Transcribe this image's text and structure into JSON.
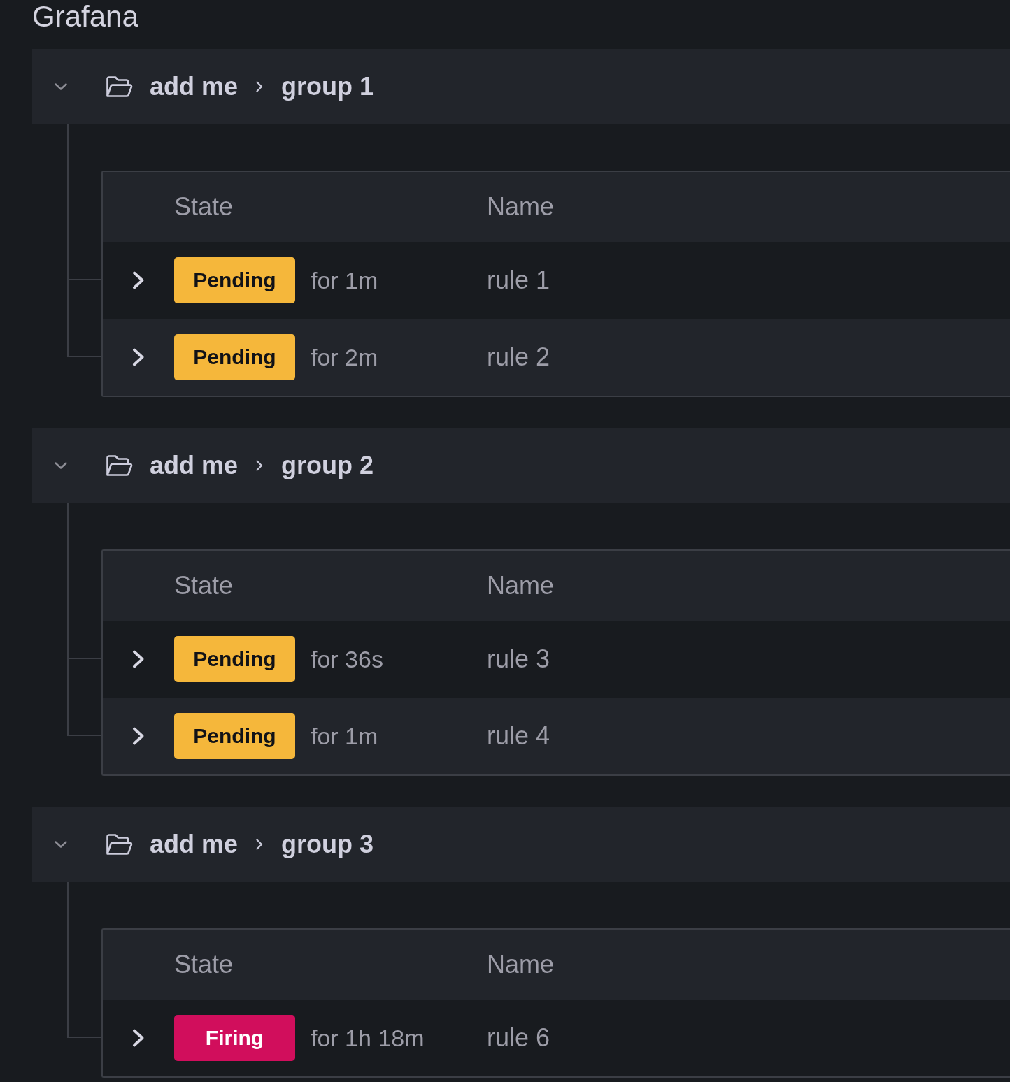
{
  "datasource": {
    "title": "Grafana"
  },
  "groups": [
    {
      "folder": "add me",
      "name": "group 1",
      "expanded": true,
      "columns": [
        "State",
        "Name"
      ],
      "rules": [
        {
          "state": "Pending",
          "kind": "pending",
          "duration": "for 1m",
          "name": "rule 1",
          "expanded": false
        },
        {
          "state": "Pending",
          "kind": "pending",
          "duration": "for 2m",
          "name": "rule 2",
          "expanded": false
        }
      ]
    },
    {
      "folder": "add me",
      "name": "group 2",
      "expanded": true,
      "columns": [
        "State",
        "Name"
      ],
      "rules": [
        {
          "state": "Pending",
          "kind": "pending",
          "duration": "for 36s",
          "name": "rule 3",
          "expanded": false
        },
        {
          "state": "Pending",
          "kind": "pending",
          "duration": "for 1m",
          "name": "rule 4",
          "expanded": false
        }
      ]
    },
    {
      "folder": "add me",
      "name": "group 3",
      "expanded": true,
      "columns": [
        "State",
        "Name"
      ],
      "rules": [
        {
          "state": "Firing",
          "kind": "firing",
          "duration": "for 1h 18m",
          "name": "rule 6",
          "expanded": false
        }
      ]
    }
  ]
}
